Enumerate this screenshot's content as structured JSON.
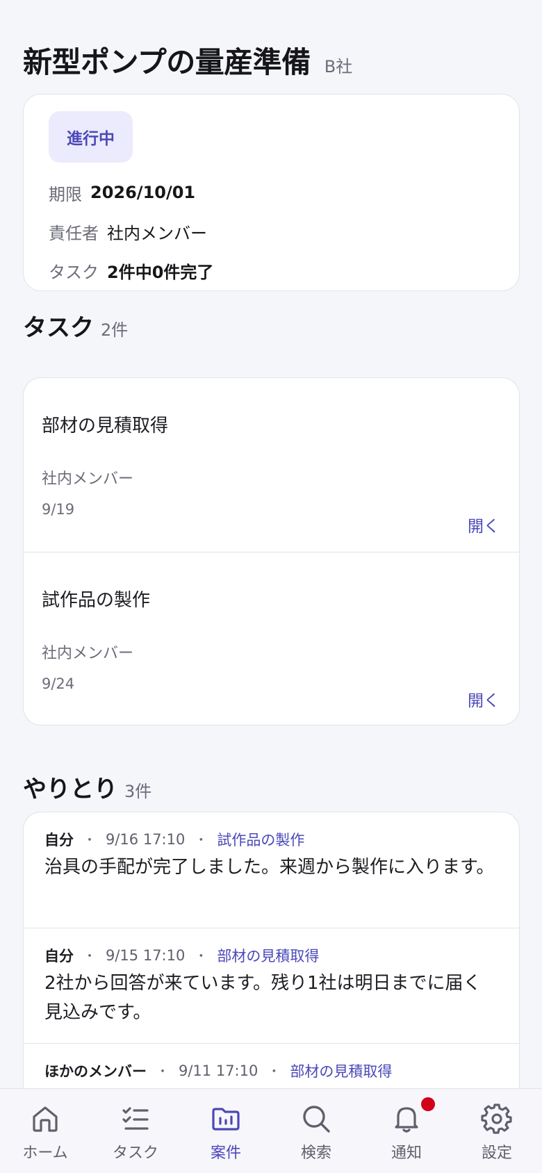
{
  "header": {
    "title": "新型ポンプの量産準備",
    "client": "B社"
  },
  "summary": {
    "status": "進行中",
    "deadline_label": "期限",
    "deadline_value": "2026/10/01",
    "owner_label": "責任者",
    "owner_value": "社内メンバー",
    "tasks_label": "タスク",
    "tasks_value": "2件中0件完了"
  },
  "tasks_section": {
    "title": "タスク",
    "count": "2件",
    "items": [
      {
        "name": "部材の見積取得",
        "owner": "社内メンバー",
        "date": "9/19",
        "open": "開く"
      },
      {
        "name": "試作品の製作",
        "owner": "社内メンバー",
        "date": "9/24",
        "open": "開く"
      }
    ]
  },
  "messages_section": {
    "title": "やりとり",
    "count": "3件",
    "items": [
      {
        "author": "自分",
        "time": "9/16 17:10",
        "task": "試作品の製作",
        "body": "治具の手配が完了しました。来週から製作に入ります。"
      },
      {
        "author": "自分",
        "time": "9/15 17:10",
        "task": "部材の見積取得",
        "body": "2社から回答が来ています。残り1社は明日までに届く見込みです。"
      },
      {
        "author": "ほかのメンバー",
        "time": "9/11 17:10",
        "task": "部材の見積取得",
        "body": ""
      }
    ],
    "separator": "・"
  },
  "tabbar": {
    "items": [
      {
        "label": "ホーム",
        "icon": "home-icon"
      },
      {
        "label": "タスク",
        "icon": "checklist-icon"
      },
      {
        "label": "案件",
        "icon": "folder-icon",
        "active": true
      },
      {
        "label": "検索",
        "icon": "search-icon"
      },
      {
        "label": "通知",
        "icon": "bell-icon",
        "badge": true
      },
      {
        "label": "設定",
        "icon": "gear-icon"
      }
    ]
  },
  "colors": {
    "accent": "#4a48b8",
    "badge": "#d0021b",
    "background": "#f5f6fa"
  }
}
